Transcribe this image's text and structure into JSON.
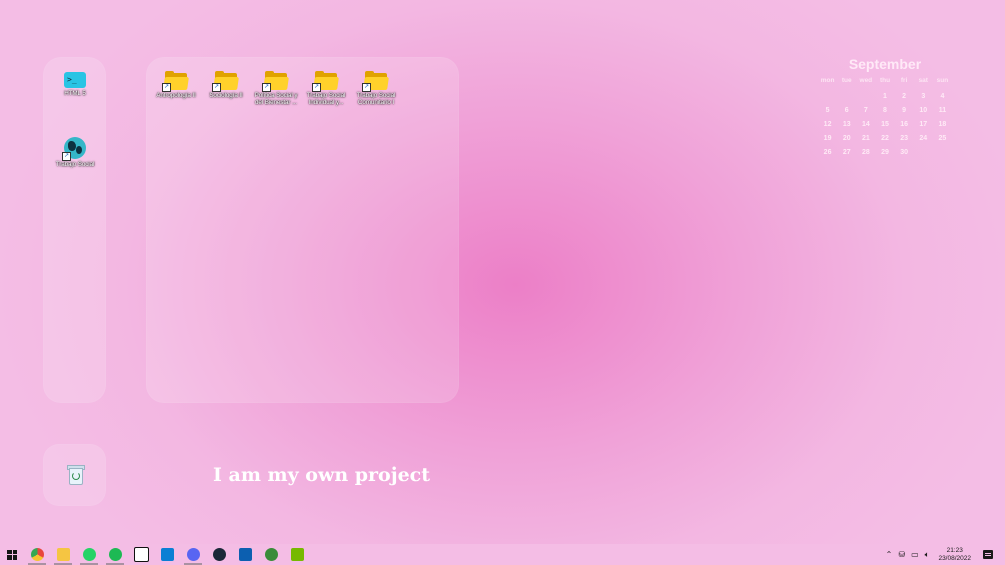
{
  "desktop": {
    "left_icons": [
      {
        "label": "HTML 5",
        "icon": "terminal-icon"
      },
      {
        "label": "Trabajo Social",
        "icon": "globe-icon"
      }
    ],
    "folders": [
      {
        "label": "Antropología II",
        "icon": "folder-icon"
      },
      {
        "label": "Sociología II",
        "icon": "folder-icon"
      },
      {
        "label": "Política Social y del Bienestar ...",
        "icon": "folder-icon"
      },
      {
        "label": "Trabajo Social Individual y...",
        "icon": "folder-icon"
      },
      {
        "label": "Trabajo Social Comunitario I",
        "icon": "folder-icon"
      }
    ],
    "recycle_bin_icon": "recycle-bin-icon",
    "motto": "I am my own project"
  },
  "calendar": {
    "month": "September",
    "weekdays": [
      "mon",
      "tue",
      "wed",
      "thu",
      "fri",
      "sat",
      "sun"
    ],
    "weeks": [
      [
        "",
        "",
        "",
        "1",
        "2",
        "3",
        "4"
      ],
      [
        "5",
        "6",
        "7",
        "8",
        "9",
        "10",
        "11"
      ],
      [
        "12",
        "13",
        "14",
        "15",
        "16",
        "17",
        "18"
      ],
      [
        "19",
        "20",
        "21",
        "22",
        "23",
        "24",
        "25"
      ],
      [
        "26",
        "27",
        "28",
        "29",
        "30",
        "",
        ""
      ]
    ]
  },
  "taskbar": {
    "start_icon": "windows-start-icon",
    "apps": [
      {
        "name": "chrome-icon",
        "color": "#e8453c",
        "running": true
      },
      {
        "name": "file-explorer-icon",
        "color": "#f5c542",
        "running": true
      },
      {
        "name": "whatsapp-icon",
        "color": "#25d366",
        "running": true
      },
      {
        "name": "spotify-icon",
        "color": "#1db954",
        "running": true
      },
      {
        "name": "notion-icon",
        "color": "#ffffff",
        "running": false
      },
      {
        "name": "vscode-icon",
        "color": "#0a7fd4",
        "running": false
      },
      {
        "name": "discord-icon",
        "color": "#5865f2",
        "running": true
      },
      {
        "name": "steam-icon",
        "color": "#1b2838",
        "running": false
      },
      {
        "name": "microsoft-store-icon",
        "color": "#0c5fb0",
        "running": false
      },
      {
        "name": "xbox-icon",
        "color": "#3a8c3a",
        "running": false
      },
      {
        "name": "nvidia-icon",
        "color": "#76b900",
        "running": false
      }
    ],
    "tray_icons": [
      "chevron-up-icon",
      "usb-icon",
      "network-icon",
      "volume-icon"
    ],
    "time": "21:23",
    "date": "23/08/2022",
    "notification_icon": "notification-icon"
  }
}
